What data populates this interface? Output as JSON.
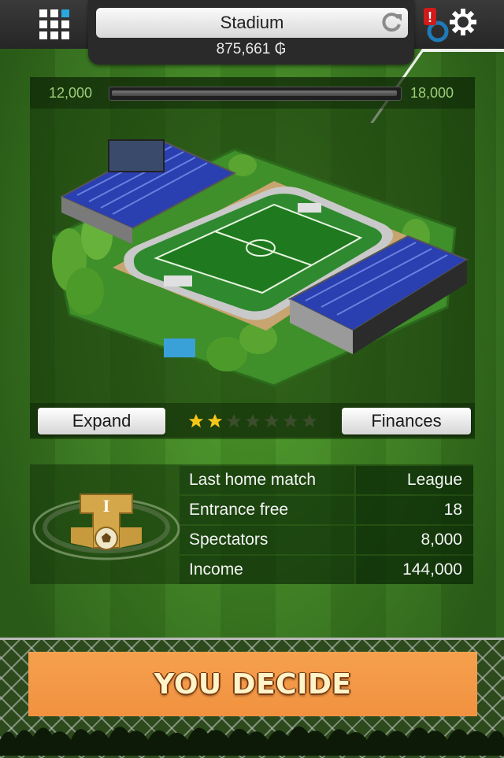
{
  "header": {
    "title": "Stadium",
    "balance": "875,661",
    "currency_symbol": "₲",
    "icons": [
      "grid-menu-icon",
      "refresh-icon",
      "alert-icon",
      "gear-icon"
    ],
    "alert_badge": "!"
  },
  "capacity": {
    "min_label": "12,000",
    "max_label": "18,000",
    "progress": 0.0
  },
  "actions": {
    "expand_label": "Expand",
    "finances_label": "Finances",
    "rating": {
      "filled": 2,
      "total": 7
    }
  },
  "match_info": {
    "rows": [
      {
        "label": "Last home match",
        "value": "League"
      },
      {
        "label": "Entrance free",
        "value": "18"
      },
      {
        "label": "Spectators",
        "value": "8,000"
      },
      {
        "label": "Income",
        "value": "144,000"
      }
    ],
    "badge_letter": "I"
  },
  "cta": {
    "label": "YOU DECIDE"
  },
  "colors": {
    "cta": "#f19240",
    "star_filled": "#f5c518",
    "star_empty": "#3b4d2c",
    "panel": "#143208"
  }
}
